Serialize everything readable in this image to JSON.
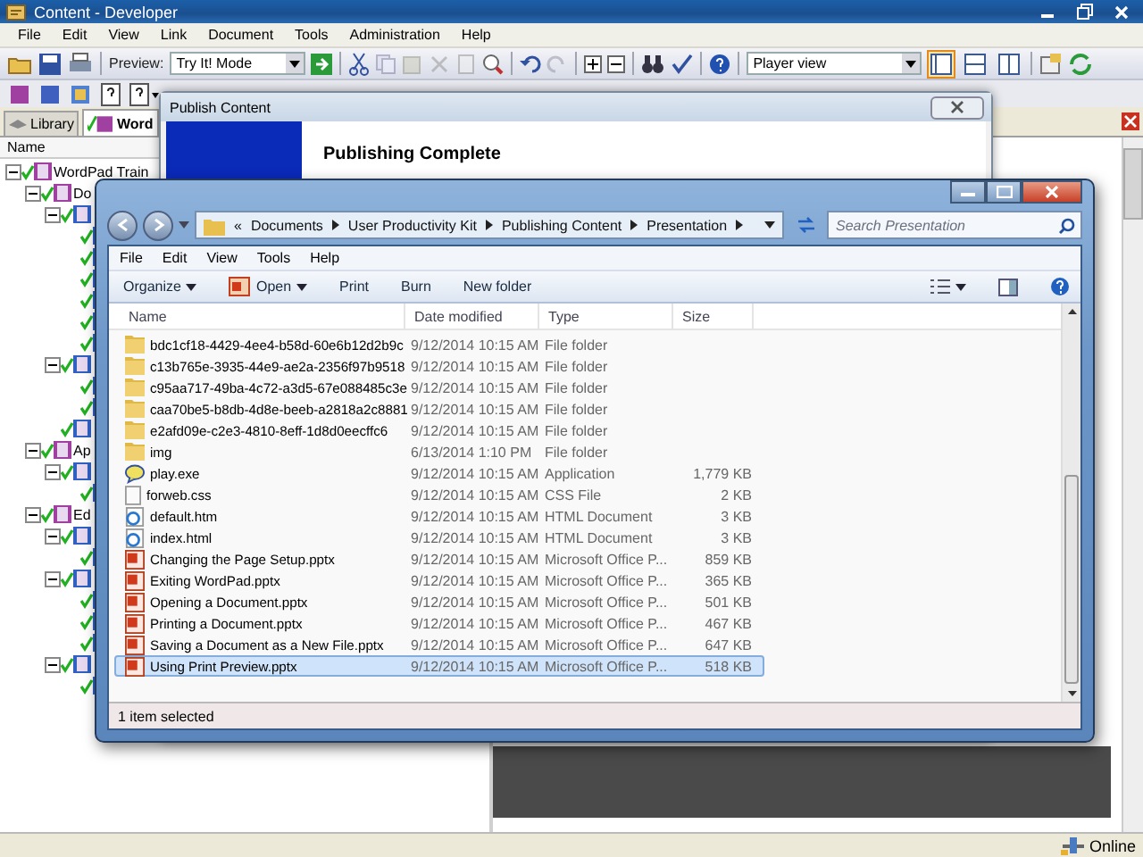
{
  "window": {
    "title": "Content - Developer"
  },
  "menu": [
    "File",
    "Edit",
    "View",
    "Link",
    "Document",
    "Tools",
    "Administration",
    "Help"
  ],
  "toolbar": {
    "preview_label": "Preview:",
    "preview_mode": "Try It! Mode",
    "view_mode": "Player view"
  },
  "layout_buttons": [
    {
      "selected": true
    },
    {
      "selected": false
    },
    {
      "selected": false
    }
  ],
  "tabs": [
    {
      "label": "Library",
      "selected": false
    },
    {
      "label": "Word",
      "selected": true
    }
  ],
  "tree": {
    "header": "Name",
    "items": [
      {
        "label": "WordPad Train",
        "checked": true,
        "expanded": true,
        "children": [
          {
            "label": "Do",
            "checked": true,
            "expanded": true,
            "children": [
              {
                "checked": true,
                "expanded": true,
                "children": [
                  {
                    "checked": true
                  },
                  {
                    "checked": true
                  },
                  {
                    "checked": true
                  },
                  {
                    "checked": true
                  },
                  {
                    "checked": true
                  },
                  {
                    "checked": true
                  }
                ]
              },
              {
                "checked": true,
                "expanded": true,
                "children": [
                  {
                    "checked": true
                  },
                  {
                    "checked": true
                  }
                ]
              },
              {
                "checked": true
              }
            ]
          },
          {
            "label": "Ap",
            "checked": true,
            "expanded": true,
            "children": [
              {
                "checked": true,
                "expanded": true,
                "children": [
                  {
                    "checked": true
                  }
                ]
              }
            ]
          },
          {
            "label": "Ed",
            "checked": true,
            "expanded": true,
            "children": [
              {
                "checked": true,
                "expanded": true,
                "children": [
                  {
                    "checked": true
                  }
                ]
              },
              {
                "checked": true,
                "expanded": true,
                "children": [
                  {
                    "checked": true
                  },
                  {
                    "checked": true
                  },
                  {
                    "checked": true
                  }
                ]
              },
              {
                "checked": true,
                "expanded": true,
                "children": [
                  {
                    "checked": true
                  }
                ]
              }
            ]
          }
        ]
      }
    ]
  },
  "publish_dialog": {
    "title": "Publish Content",
    "heading": "Publishing Complete"
  },
  "explorer": {
    "overflow_marker": "«",
    "breadcrumb": [
      "Documents",
      "User Productivity Kit",
      "Publishing Content",
      "Presentation"
    ],
    "search": {
      "placeholder": "Search Presentation"
    },
    "menu": [
      "File",
      "Edit",
      "View",
      "Tools",
      "Help"
    ],
    "commands": [
      {
        "label": "Organize",
        "kind": "dropdown"
      },
      {
        "label": "Open",
        "kind": "open"
      },
      {
        "label": "Print",
        "kind": "plain"
      },
      {
        "label": "Burn",
        "kind": "plain"
      },
      {
        "label": "New folder",
        "kind": "plain"
      }
    ],
    "columns": [
      "Name",
      "Date modified",
      "Type",
      "Size"
    ],
    "files": [
      {
        "kind": "folder",
        "name": "bdc1cf18-4429-4ee4-b58d-60e6b12d2b9c",
        "date": "9/12/2014 10:15 AM",
        "type": "File folder",
        "selected": false
      },
      {
        "kind": "folder",
        "name": "c13b765e-3935-44e9-ae2a-2356f97b9518",
        "date": "9/12/2014 10:15 AM",
        "type": "File folder",
        "selected": false
      },
      {
        "kind": "folder",
        "name": "c95aa717-49ba-4c72-a3d5-67e088485c3e",
        "date": "9/12/2014 10:15 AM",
        "type": "File folder",
        "selected": false
      },
      {
        "kind": "folder",
        "name": "caa70be5-b8db-4d8e-beeb-a2818a2c8881",
        "date": "9/12/2014 10:15 AM",
        "type": "File folder",
        "selected": false
      },
      {
        "kind": "folder",
        "name": "e2afd09e-c2e3-4810-8eff-1d8d0eecffc6",
        "date": "9/12/2014 10:15 AM",
        "type": "File folder",
        "selected": false
      },
      {
        "kind": "folder",
        "name": "img",
        "date": "6/13/2014 1:10 PM",
        "type": "File folder",
        "selected": false
      },
      {
        "kind": "app",
        "name": "play.exe",
        "date": "9/12/2014 10:15 AM",
        "type": "Application",
        "size": "1,779 KB",
        "selected": false
      },
      {
        "kind": "css",
        "name": "forweb.css",
        "date": "9/12/2014 10:15 AM",
        "type": "CSS File",
        "size": "2 KB",
        "selected": false
      },
      {
        "kind": "html",
        "name": "default.htm",
        "date": "9/12/2014 10:15 AM",
        "type": "HTML Document",
        "size": "3 KB",
        "selected": false
      },
      {
        "kind": "html",
        "name": "index.html",
        "date": "9/12/2014 10:15 AM",
        "type": "HTML Document",
        "size": "3 KB",
        "selected": false
      },
      {
        "kind": "pptx",
        "name": "Changing the Page Setup.pptx",
        "date": "9/12/2014 10:15 AM",
        "type": "Microsoft Office P...",
        "size": "859 KB",
        "selected": false
      },
      {
        "kind": "pptx",
        "name": "Exiting WordPad.pptx",
        "date": "9/12/2014 10:15 AM",
        "type": "Microsoft Office P...",
        "size": "365 KB",
        "selected": false
      },
      {
        "kind": "pptx",
        "name": "Opening a Document.pptx",
        "date": "9/12/2014 10:15 AM",
        "type": "Microsoft Office P...",
        "size": "501 KB",
        "selected": false
      },
      {
        "kind": "pptx",
        "name": "Printing a Document.pptx",
        "date": "9/12/2014 10:15 AM",
        "type": "Microsoft Office P...",
        "size": "467 KB",
        "selected": false
      },
      {
        "kind": "pptx",
        "name": "Saving a Document as a New File.pptx",
        "date": "9/12/2014 10:15 AM",
        "type": "Microsoft Office P...",
        "size": "647 KB",
        "selected": false
      },
      {
        "kind": "pptx",
        "name": "Using Print Preview.pptx",
        "date": "9/12/2014 10:15 AM",
        "type": "Microsoft Office P...",
        "size": "518 KB",
        "selected": true
      }
    ],
    "status": "1 item selected"
  },
  "status_bar": {
    "connection": "Online"
  }
}
